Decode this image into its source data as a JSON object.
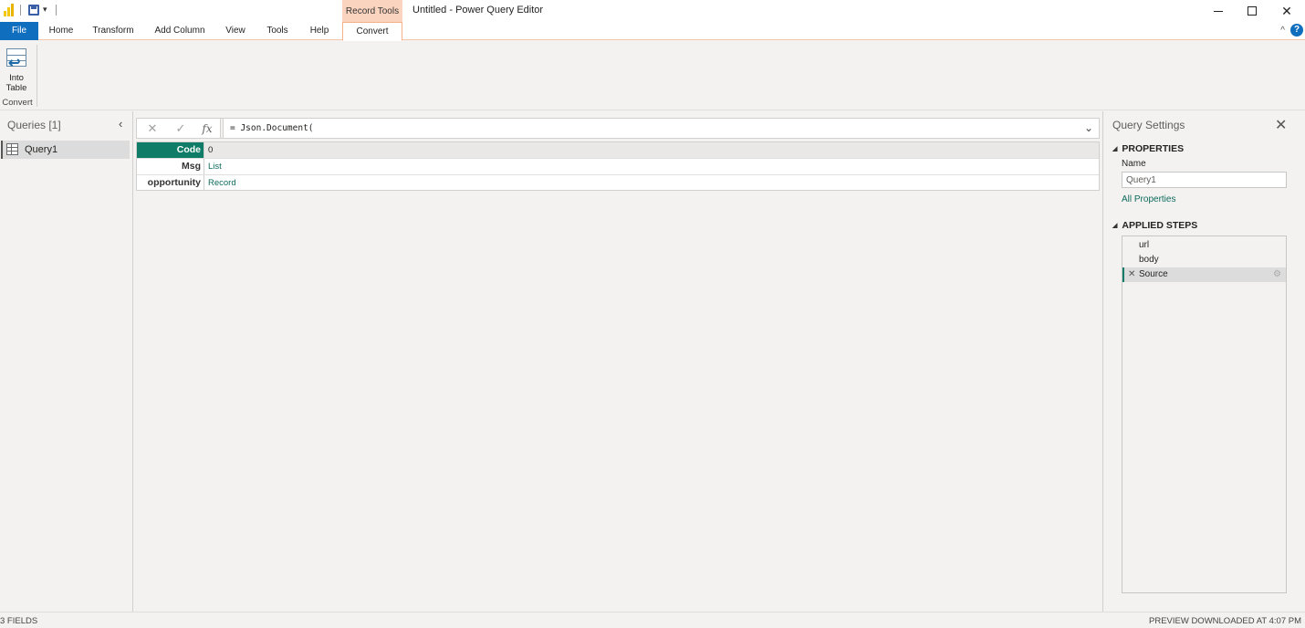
{
  "titlebar": {
    "context_tab": "Record Tools",
    "window_title": "Untitled - Power Query Editor",
    "minimize": "",
    "maximize": "",
    "close": "✕"
  },
  "ribbon_tabs": [
    "File",
    "Home",
    "Transform",
    "Add Column",
    "View",
    "Tools",
    "Help",
    "Convert"
  ],
  "ribbon": {
    "button_line1": "Into",
    "button_line2": "Table",
    "group_label": "Convert"
  },
  "queries": {
    "title": "Queries [1]",
    "items": [
      {
        "label": "Query1"
      }
    ]
  },
  "formula_bar": {
    "formula": "= Json.Document("
  },
  "record": [
    {
      "key": "Code",
      "value": "0"
    },
    {
      "key": "Msg",
      "value": "List"
    },
    {
      "key": "opportunity",
      "value": "Record"
    }
  ],
  "settings": {
    "title": "Query Settings",
    "properties_head": "PROPERTIES",
    "name_label": "Name",
    "name_value": "Query1",
    "all_properties": "All Properties",
    "steps_head": "APPLIED STEPS",
    "steps": [
      "url",
      "body",
      "Source"
    ]
  },
  "status": {
    "left": "3 FIELDS",
    "right": "PREVIEW DOWNLOADED AT 4:07 PM"
  },
  "colors": {
    "accent_teal": "#0e7c66",
    "file_tab": "#106ebe",
    "context_tab": "#fbd4bf"
  }
}
